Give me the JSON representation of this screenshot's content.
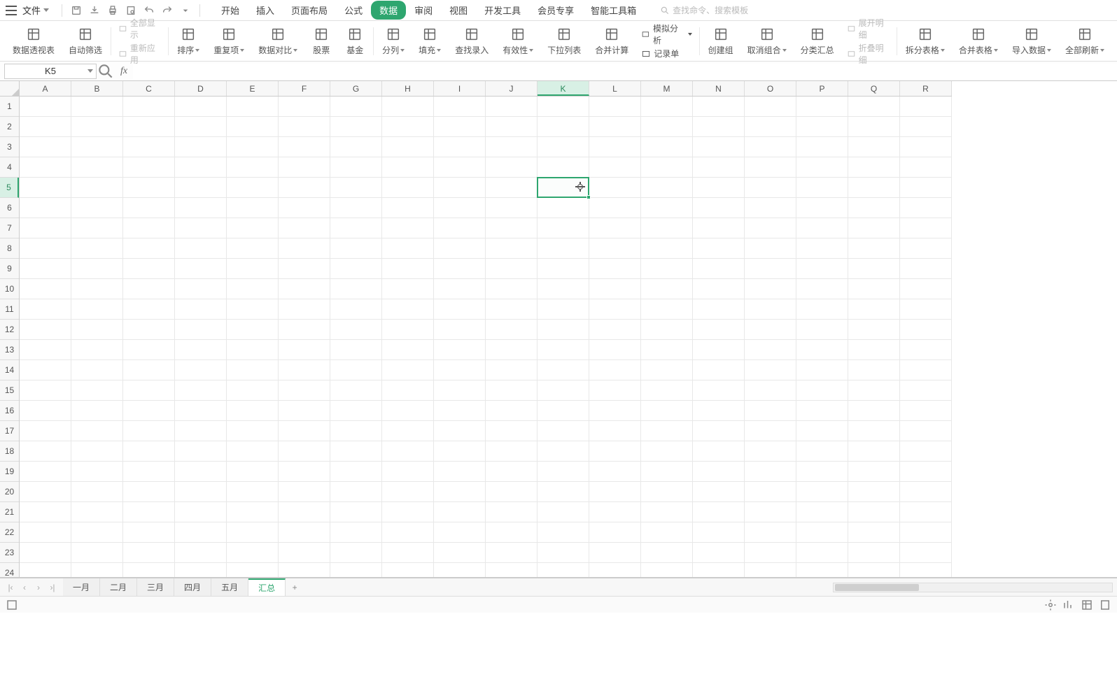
{
  "menubar": {
    "file_label": "文件",
    "tabs": [
      "开始",
      "插入",
      "页面布局",
      "公式",
      "数据",
      "审阅",
      "视图",
      "开发工具",
      "会员专享",
      "智能工具箱"
    ],
    "active_tab_index": 4,
    "search_placeholder": "查找命令、搜索模板"
  },
  "ribbon": {
    "groups": [
      {
        "label": "数据透视表",
        "caret": false
      },
      {
        "label": "自动筛选",
        "caret": false
      },
      {
        "small": [
          {
            "label": "全部显示",
            "dark": false
          },
          {
            "label": "重新应用",
            "dark": false
          }
        ]
      },
      {
        "label": "排序",
        "caret": true
      },
      {
        "label": "重复项",
        "caret": true
      },
      {
        "label": "数据对比",
        "caret": true
      },
      {
        "label": "股票",
        "caret": false
      },
      {
        "label": "基金",
        "caret": false
      },
      {
        "label": "分列",
        "caret": true
      },
      {
        "label": "填充",
        "caret": true
      },
      {
        "label": "查找录入",
        "caret": false
      },
      {
        "label": "有效性",
        "caret": true
      },
      {
        "label": "下拉列表",
        "caret": false
      },
      {
        "label": "合并计算",
        "caret": false
      },
      {
        "small": [
          {
            "label": "模拟分析",
            "dark": true,
            "caret": true
          },
          {
            "label": "记录单",
            "dark": true
          }
        ]
      },
      {
        "label": "创建组",
        "caret": false
      },
      {
        "label": "取消组合",
        "caret": true
      },
      {
        "label": "分类汇总",
        "caret": false
      },
      {
        "small": [
          {
            "label": "展开明细",
            "dark": false
          },
          {
            "label": "折叠明细",
            "dark": false
          }
        ]
      },
      {
        "label": "拆分表格",
        "caret": true
      },
      {
        "label": "合并表格",
        "caret": true
      },
      {
        "label": "导入数据",
        "caret": true
      },
      {
        "label": "全部刷新",
        "caret": true
      }
    ]
  },
  "formula_bar": {
    "name_box": "K5",
    "fx": "fx"
  },
  "grid": {
    "columns": [
      "A",
      "B",
      "C",
      "D",
      "E",
      "F",
      "G",
      "H",
      "I",
      "J",
      "K",
      "L",
      "M",
      "N",
      "O",
      "P",
      "Q",
      "R"
    ],
    "rows": [
      1,
      2,
      3,
      4,
      5,
      6,
      7,
      8,
      9,
      10,
      11,
      12,
      13,
      14,
      15,
      16,
      17,
      18,
      19,
      20,
      21,
      22,
      23,
      24
    ],
    "selected_col_index": 10,
    "selected_row_index": 4
  },
  "sheets": {
    "tabs": [
      "一月",
      "二月",
      "三月",
      "四月",
      "五月",
      "汇总"
    ],
    "active_index": 5
  }
}
